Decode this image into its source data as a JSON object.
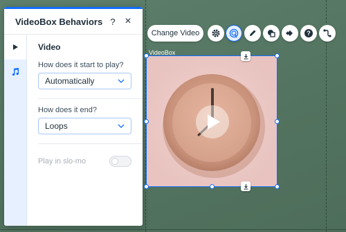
{
  "panel": {
    "title": "VideoBox Behaviors",
    "help_symbol": "?",
    "close_symbol": "×",
    "section_title": "Video",
    "start_label": "How does it start to play?",
    "start_value": "Automatically",
    "end_label": "How does it end?",
    "end_value": "Loops",
    "slomo_label": "Play in slo-mo",
    "slomo_on": false
  },
  "toolbar": {
    "change_video_label": "Change Video",
    "tools": [
      "gear-icon",
      "behaviors-icon",
      "pen-icon",
      "mask-icon",
      "animation-icon",
      "help-icon",
      "connect-icon"
    ]
  },
  "element": {
    "label": "VideoBox",
    "media": "clock-video"
  },
  "colors": {
    "accent": "#116dff",
    "canvas": "#587a66",
    "video_bg": "#ecc9c6"
  }
}
